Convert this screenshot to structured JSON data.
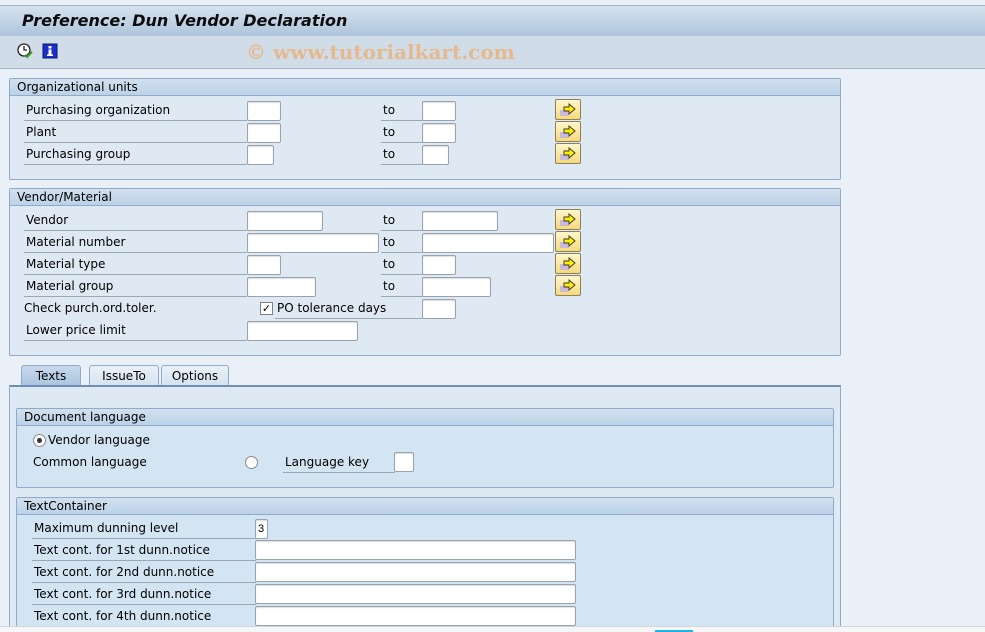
{
  "window": {
    "title": "Preference: Dun Vendor Declaration",
    "watermark": "© www.tutorialkart.com"
  },
  "toolbar": {
    "icons": [
      "execute-clock-icon",
      "info-icon"
    ]
  },
  "org_units": {
    "title": "Organizational units",
    "to_label": "to",
    "rows": [
      {
        "label": "Purchasing organization",
        "from": "",
        "to": ""
      },
      {
        "label": "Plant",
        "from": "",
        "to": ""
      },
      {
        "label": "Purchasing group",
        "from": "",
        "to": ""
      }
    ]
  },
  "vendor_material": {
    "title": "Vendor/Material",
    "to_label": "to",
    "rows": [
      {
        "label": "Vendor",
        "from": "",
        "to": ""
      },
      {
        "label": "Material number",
        "from": "",
        "to": ""
      },
      {
        "label": "Material type",
        "from": "",
        "to": ""
      },
      {
        "label": "Material group",
        "from": "",
        "to": ""
      }
    ],
    "check_tol_label": "Check purch.ord.toler.",
    "po_tolerance_label": "PO tolerance days",
    "po_tolerance_checked": true,
    "po_tolerance_value": "",
    "lower_price_label": "Lower price limit",
    "lower_price_value": ""
  },
  "tabs": [
    {
      "label": "Texts",
      "active": true
    },
    {
      "label": "IssueTo",
      "active": false
    },
    {
      "label": "Options",
      "active": false
    }
  ],
  "doc_language": {
    "title": "Document language",
    "vendor_language_label": "Vendor language",
    "vendor_language_selected": true,
    "common_language_label": "Common language",
    "common_language_selected": false,
    "language_key_label": "Language key",
    "language_key_value": ""
  },
  "text_container": {
    "title": "TextContainer",
    "max_level_label": "Maximum dunning level",
    "max_level_value": "3",
    "rows": [
      {
        "label": "Text cont. for 1st dunn.notice",
        "value": ""
      },
      {
        "label": "Text cont. for 2nd dunn.notice",
        "value": ""
      },
      {
        "label": "Text cont. for 3rd dunn.notice",
        "value": ""
      },
      {
        "label": "Text cont. for 4th dunn.notice",
        "value": ""
      }
    ]
  }
}
